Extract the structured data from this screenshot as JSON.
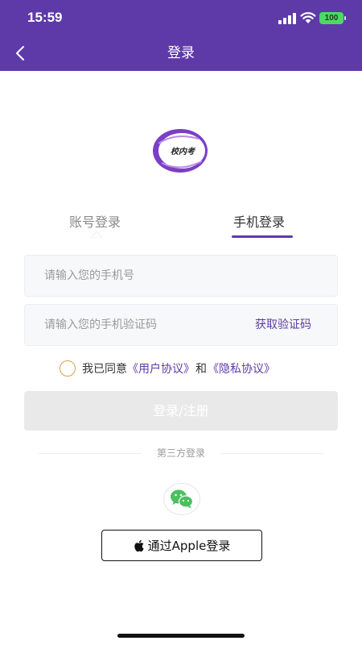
{
  "status_bar": {
    "time": "15:59",
    "battery": "100"
  },
  "nav": {
    "title": "登录"
  },
  "logo": {
    "text": "校内考"
  },
  "tabs": [
    {
      "label": "账号登录",
      "active": false
    },
    {
      "label": "手机登录",
      "active": true
    }
  ],
  "form": {
    "phone_placeholder": "请输入您的手机号",
    "code_placeholder": "请输入您的手机验证码",
    "get_code_label": "获取验证码"
  },
  "agreement": {
    "prefix": "我已同意",
    "user_agreement": "《用户协议》",
    "and": "和",
    "privacy_policy": "《隐私协议》"
  },
  "login_button": {
    "label": "登录/注册"
  },
  "third_party": {
    "label": "第三方登录",
    "wechat_icon": "wechat-icon"
  },
  "apple_login": {
    "label": "通过Apple登录"
  },
  "colors": {
    "brand": "#5e3aa8",
    "accent": "#d4a24c",
    "wechat": "#4cbf5f"
  }
}
